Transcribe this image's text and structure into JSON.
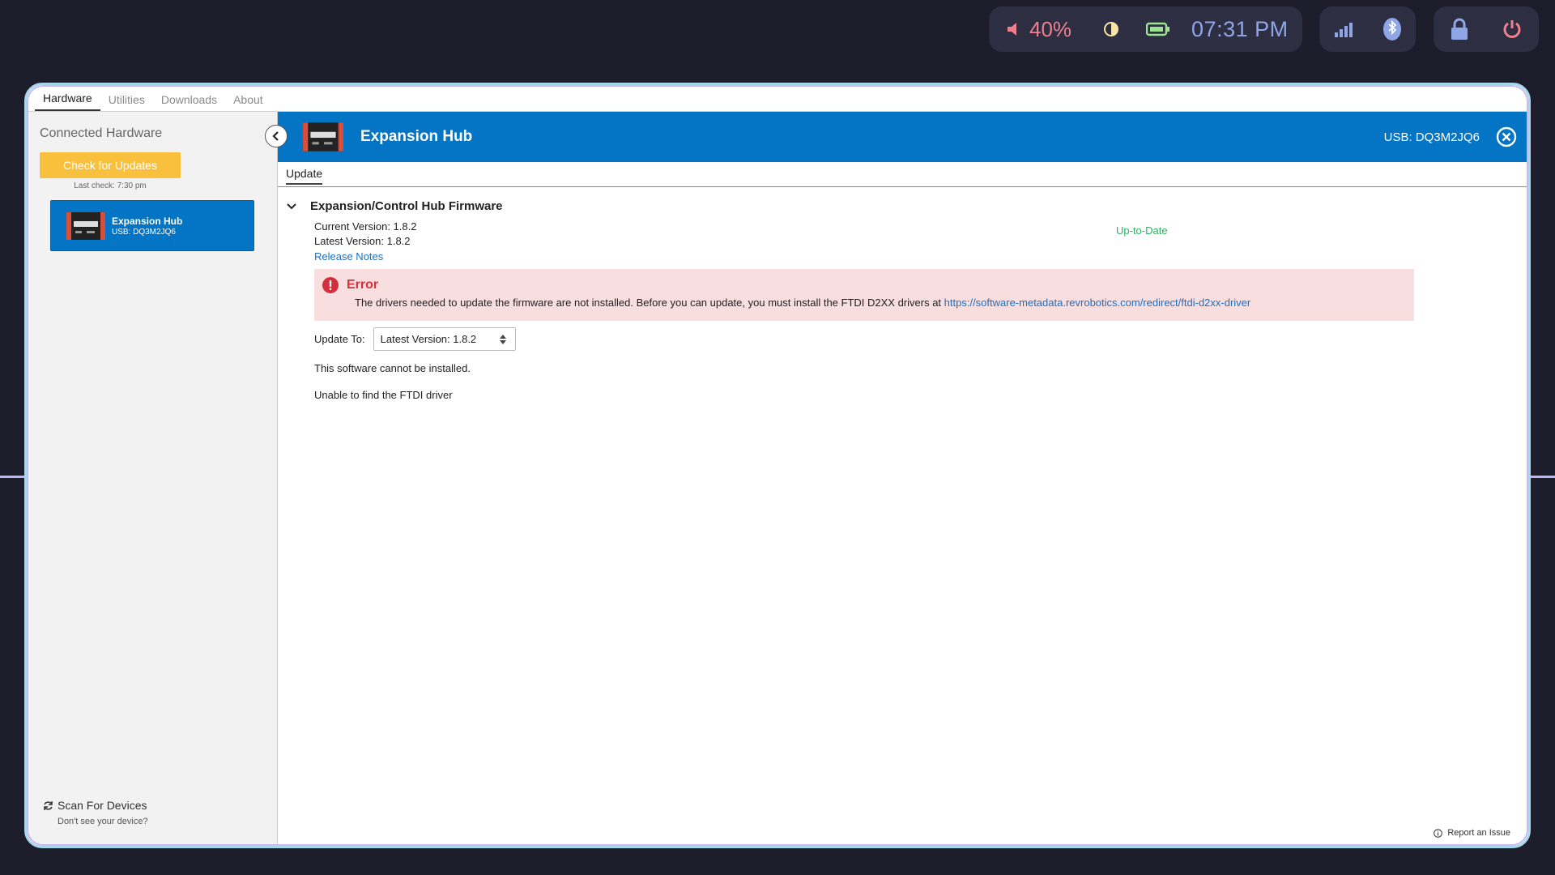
{
  "system_bar": {
    "volume": "40%",
    "time": "07:31 PM",
    "icons": [
      "speaker-icon",
      "brightness-icon",
      "battery-icon",
      "signal-icon",
      "bluetooth-icon",
      "lock-icon",
      "power-icon"
    ]
  },
  "app_tabs": [
    {
      "label": "Hardware",
      "active": true
    },
    {
      "label": "Utilities",
      "active": false
    },
    {
      "label": "Downloads",
      "active": false
    },
    {
      "label": "About",
      "active": false
    }
  ],
  "sidebar": {
    "title": "Connected Hardware",
    "check_updates_label": "Check for Updates",
    "last_check": "Last check: 7:30 pm",
    "device": {
      "name": "Expansion Hub",
      "usb": "USB: DQ3M2JQ6"
    },
    "scan_label": "Scan For Devices",
    "scan_help": "Don't see your device?"
  },
  "header": {
    "title": "Expansion Hub",
    "usb": "USB: DQ3M2JQ6"
  },
  "subtab": "Update",
  "firmware": {
    "title": "Expansion/Control Hub Firmware",
    "current_version": "Current Version:  1.8.2",
    "latest_version": "Latest Version:  1.8.2",
    "status": "Up-to-Date",
    "release_notes": "Release Notes"
  },
  "error": {
    "title": "Error",
    "message": "The drivers needed to update the firmware are not installed. Before you can update, you must install the FTDI D2XX drivers at ",
    "link": "https://software-metadata.revrobotics.com/redirect/ftdi-d2xx-driver"
  },
  "update_to": {
    "label": "Update To:",
    "selected": "Latest Version: 1.8.2"
  },
  "messages": {
    "cannot_install": "This software cannot be installed.",
    "driver_missing": "Unable to find the FTDI driver"
  },
  "footer": {
    "report": "Report an Issue"
  },
  "colors": {
    "accent_blue": "#0474c4",
    "update_yellow": "#f9c03d",
    "error_red": "#d2303c",
    "success_green": "#2fb35e"
  }
}
